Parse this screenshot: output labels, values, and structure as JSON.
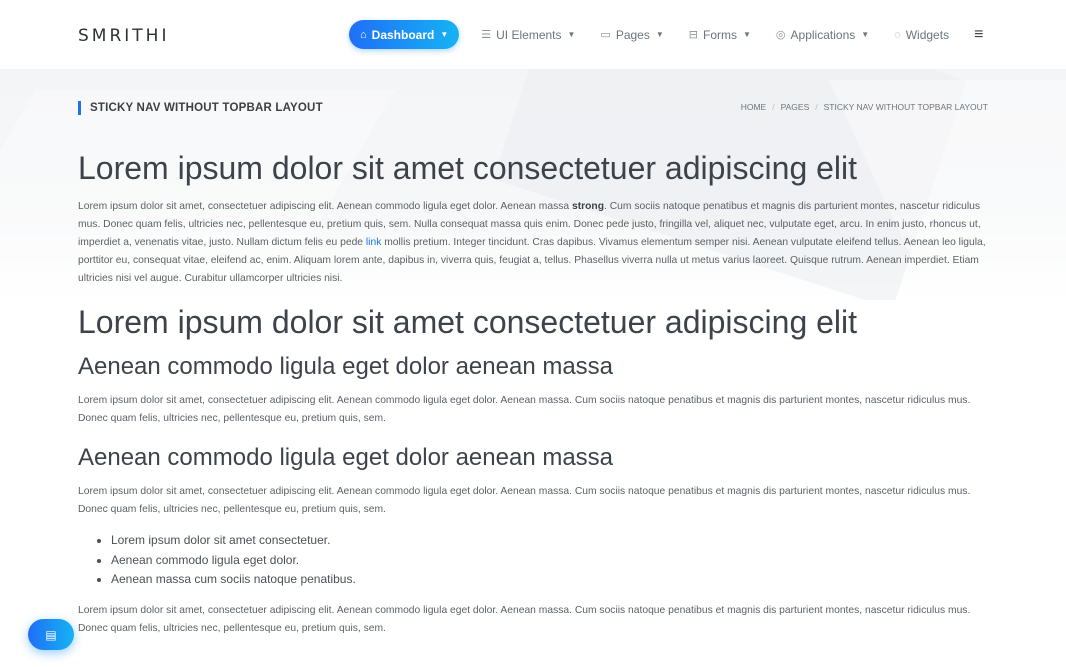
{
  "brand": "SMRITHI",
  "nav": [
    {
      "label": "Dashboard",
      "icon": "home-icon",
      "glyph": "⌂",
      "caret": true,
      "active": true
    },
    {
      "label": "UI Elements",
      "icon": "list-icon",
      "glyph": "☰",
      "caret": true
    },
    {
      "label": "Pages",
      "icon": "pages-icon",
      "glyph": "▭",
      "caret": true
    },
    {
      "label": "Forms",
      "icon": "forms-icon",
      "glyph": "⊟",
      "caret": true
    },
    {
      "label": "Applications",
      "icon": "apps-icon",
      "glyph": "◎",
      "caret": true
    },
    {
      "label": "Widgets",
      "icon": "widgets-icon",
      "glyph": "◌",
      "caret": false
    }
  ],
  "menu_glyph": "≡",
  "page_title": "STICKY NAV WITHOUT TOPBAR LAYOUT",
  "breadcrumb": [
    "HOME",
    "PAGES",
    "STICKY NAV WITHOUT TOPBAR LAYOUT"
  ],
  "h1_a": "Lorem ipsum dolor sit amet consectetuer adipiscing elit",
  "p1": {
    "a": "Lorem ipsum dolor sit amet, consectetuer adipiscing elit. Aenean commodo ligula eget dolor. Aenean massa ",
    "strong": "strong",
    "b": ". Cum sociis natoque penatibus et magnis dis parturient montes, nascetur ridiculus mus. Donec quam felis, ultricies nec, pellentesque eu, pretium quis, sem. Nulla consequat massa quis enim. Donec pede justo, fringilla vel, aliquet nec, vulputate eget, arcu. In enim justo, rhoncus ut, imperdiet a, venenatis vitae, justo. Nullam dictum felis eu pede ",
    "link": "link",
    "c": " mollis pretium. Integer tincidunt. Cras dapibus. Vivamus elementum semper nisi. Aenean vulputate eleifend tellus. Aenean leo ligula, porttitor eu, consequat vitae, eleifend ac, enim. Aliquam lorem ante, dapibus in, viverra quis, feugiat a, tellus. Phasellus viverra nulla ut metus varius laoreet. Quisque rutrum. Aenean imperdiet. Etiam ultricies nisi vel augue. Curabitur ullamcorper ultricies nisi."
  },
  "h1_b": "Lorem ipsum dolor sit amet consectetuer adipiscing elit",
  "h2_a": "Aenean commodo ligula eget dolor aenean massa",
  "p2": "Lorem ipsum dolor sit amet, consectetuer adipiscing elit. Aenean commodo ligula eget dolor. Aenean massa. Cum sociis natoque penatibus et magnis dis parturient montes, nascetur ridiculus mus. Donec quam felis, ultricies nec, pellentesque eu, pretium quis, sem.",
  "h2_b": "Aenean commodo ligula eget dolor aenean massa",
  "p3": "Lorem ipsum dolor sit amet, consectetuer adipiscing elit. Aenean commodo ligula eget dolor. Aenean massa. Cum sociis natoque penatibus et magnis dis parturient montes, nascetur ridiculus mus. Donec quam felis, ultricies nec, pellentesque eu, pretium quis, sem.",
  "list": [
    "Lorem ipsum dolor sit amet consectetuer.",
    "Aenean commodo ligula eget dolor.",
    "Aenean massa cum sociis natoque penatibus."
  ],
  "p4": "Lorem ipsum dolor sit amet, consectetuer adipiscing elit. Aenean commodo ligula eget dolor. Aenean massa. Cum sociis natoque penatibus et magnis dis parturient montes, nascetur ridiculus mus. Donec quam felis, ultricies nec, pellentesque eu, pretium quis, sem.",
  "fab": {
    "icon": "chat-icon",
    "glyph": "▤"
  },
  "colors": {
    "accent": "#1a73e8",
    "gradient_start": "#1f6ff7",
    "gradient_end": "#16b3f3"
  }
}
